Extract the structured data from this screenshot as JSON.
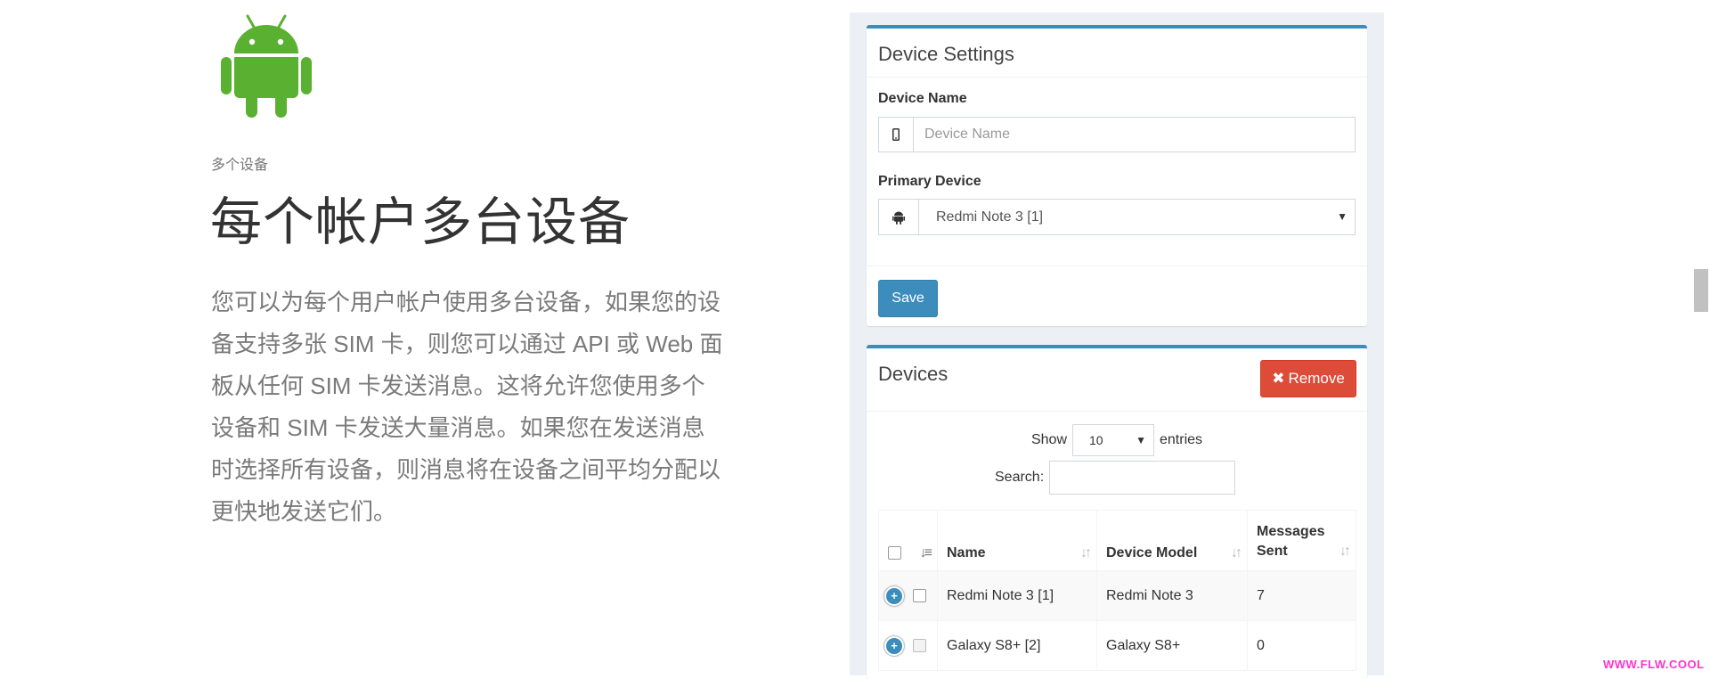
{
  "feature": {
    "kicker": "多个设备",
    "headline": "每个帐户多台设备",
    "description": "您可以为每个用户帐户使用多台设备，如果您的设备支持多张 SIM 卡，则您可以通过 API 或 Web 面板从任何 SIM 卡发送消息。这将允许您使用多个设备和 SIM 卡发送大量消息。如果您在发送消息时选择所有设备，则消息将在设备之间平均分配以更快地发送它们。"
  },
  "device_settings": {
    "title": "Device Settings",
    "device_name_label": "Device Name",
    "device_name_placeholder": "Device Name",
    "primary_device_label": "Primary Device",
    "primary_device_value": "Redmi Note 3 [1]",
    "save_label": "Save"
  },
  "devices": {
    "title": "Devices",
    "remove_label": "Remove",
    "show_label": "Show",
    "entries_value": "10",
    "entries_label": "entries",
    "search_label": "Search:",
    "columns": {
      "name": "Name",
      "model": "Device Model",
      "messages": "Messages Sent"
    },
    "rows": [
      {
        "name": "Redmi Note 3 [1]",
        "model": "Redmi Note 3",
        "messages": "7"
      },
      {
        "name": "Galaxy S8+ [2]",
        "model": "Galaxy S8+",
        "messages": "0"
      }
    ]
  },
  "watermark": "WWW.FLW.COOL",
  "colors": {
    "android": "#59b031",
    "primary": "#3c8dbc",
    "danger": "#dd4b39"
  }
}
